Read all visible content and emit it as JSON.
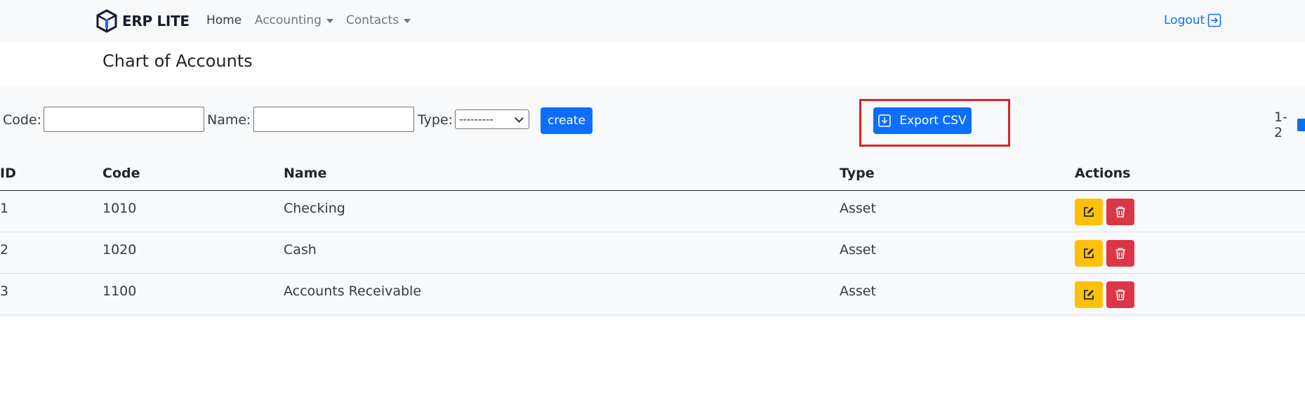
{
  "navbar": {
    "brand": "ERP LITE",
    "home": "Home",
    "accounting": "Accounting",
    "contacts": "Contacts",
    "logout": "Logout",
    "icons": {
      "brand": "cube-logo-icon",
      "logout": "logout-icon"
    }
  },
  "page": {
    "title": "Chart of Accounts"
  },
  "filters": {
    "code_label": "Code:",
    "name_label": "Name:",
    "type_label": "Type:",
    "code_value": "",
    "name_value": "",
    "type_selected": "---------",
    "create_label": "create"
  },
  "export": {
    "label": "Export CSV",
    "icon": "download-icon"
  },
  "pagination": {
    "range": "1-2"
  },
  "table": {
    "headers": {
      "id": "ID",
      "code": "Code",
      "name": "Name",
      "type": "Type",
      "actions": "Actions"
    },
    "rows": [
      {
        "id": "1",
        "code": "1010",
        "name": "Checking",
        "type": "Asset"
      },
      {
        "id": "2",
        "code": "1020",
        "name": "Cash",
        "type": "Asset"
      },
      {
        "id": "3",
        "code": "1100",
        "name": "Accounts Receivable",
        "type": "Asset"
      }
    ]
  },
  "colors": {
    "primary": "#0d6efd",
    "warning": "#ffc107",
    "danger": "#dc3545",
    "highlight": "#e02027",
    "panel": "#f8f9fa"
  }
}
